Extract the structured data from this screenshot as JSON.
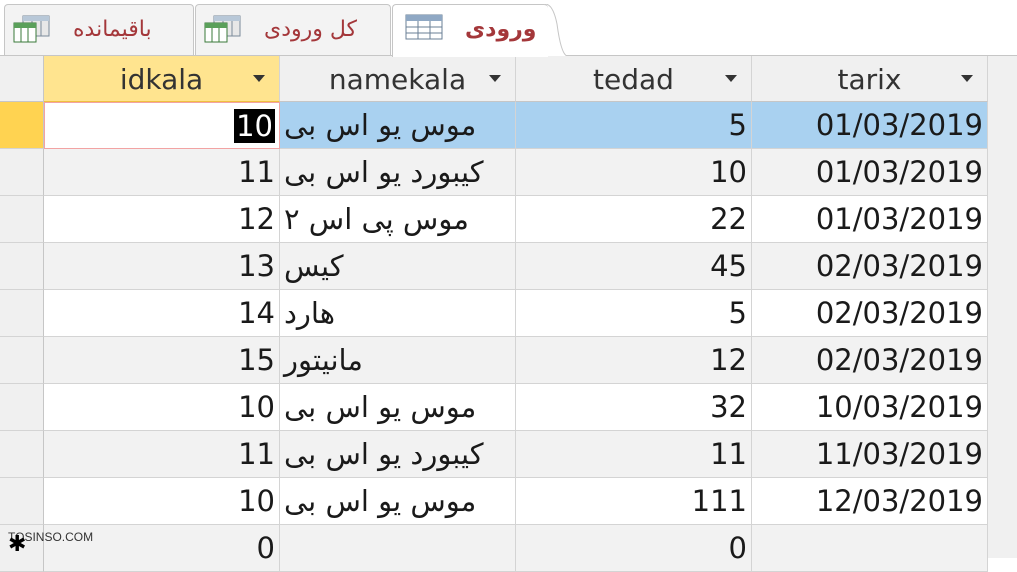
{
  "tabs": [
    {
      "label": "باقیمانده",
      "active": false,
      "icon": "query-grid-icon"
    },
    {
      "label": "کل ورودی",
      "active": false,
      "icon": "query-grid-icon"
    },
    {
      "label": "ورودی",
      "active": true,
      "icon": "table-icon"
    }
  ],
  "columns": [
    "idkala",
    "namekala",
    "tedad",
    "tarix"
  ],
  "rows": [
    {
      "idkala": "10",
      "namekala": "موس یو اس بی",
      "tedad": "5",
      "tarix": "01/03/2019"
    },
    {
      "idkala": "11",
      "namekala": "کیبورد یو اس بی",
      "tedad": "10",
      "tarix": "01/03/2019"
    },
    {
      "idkala": "12",
      "namekala": "موس پی اس ۲",
      "tedad": "22",
      "tarix": "01/03/2019"
    },
    {
      "idkala": "13",
      "namekala": "کیس",
      "tedad": "45",
      "tarix": "02/03/2019"
    },
    {
      "idkala": "14",
      "namekala": "هارد",
      "tedad": "5",
      "tarix": "02/03/2019"
    },
    {
      "idkala": "15",
      "namekala": "مانیتور",
      "tedad": "12",
      "tarix": "02/03/2019"
    },
    {
      "idkala": "10",
      "namekala": "موس یو اس بی",
      "tedad": "32",
      "tarix": "10/03/2019"
    },
    {
      "idkala": "11",
      "namekala": "کیبورد یو اس بی",
      "tedad": "11",
      "tarix": "11/03/2019"
    },
    {
      "idkala": "10",
      "namekala": "موس یو اس بی",
      "tedad": "111",
      "tarix": "12/03/2019"
    }
  ],
  "new_row": {
    "idkala": "0",
    "namekala": "",
    "tedad": "0",
    "tarix": ""
  },
  "new_record_symbol": "✱",
  "watermark": "TOSINSO.COM",
  "colors": {
    "tab_text": "#a4373a",
    "selected_header": "#ffe48f",
    "selected_row": "#a9d1f0",
    "record_selector_current": "#ffd351"
  }
}
